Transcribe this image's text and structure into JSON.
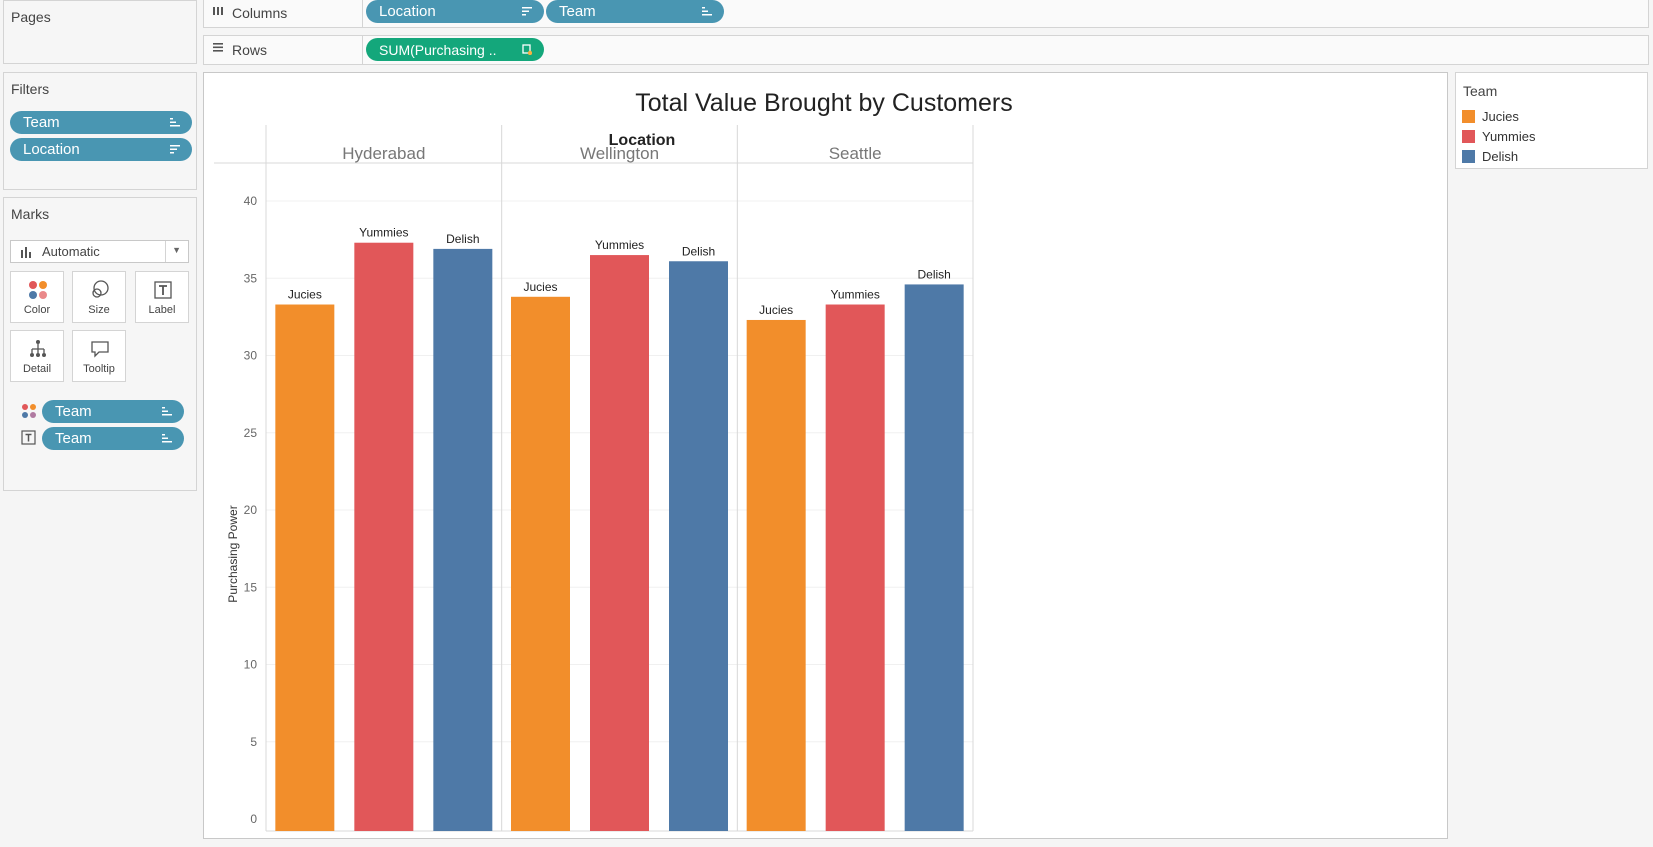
{
  "pages_panel": {
    "title": "Pages"
  },
  "columns_shelf": {
    "label": "Columns",
    "pills": [
      "Location",
      "Team"
    ]
  },
  "rows_shelf": {
    "label": "Rows",
    "pills": [
      "SUM(Purchasing .."
    ]
  },
  "filters_panel": {
    "title": "Filters",
    "pills": [
      "Team",
      "Location"
    ]
  },
  "marks_panel": {
    "title": "Marks",
    "mark_type": "Automatic",
    "buttons": [
      "Color",
      "Size",
      "Label",
      "Detail",
      "Tooltip"
    ],
    "pills": [
      "Team",
      "Team"
    ]
  },
  "legend": {
    "title": "Team",
    "items": [
      {
        "label": "Jucies",
        "color": "#f28e2b"
      },
      {
        "label": "Yummies",
        "color": "#e15759"
      },
      {
        "label": "Delish",
        "color": "#4e79a7"
      }
    ]
  },
  "chart_data": {
    "type": "bar",
    "title": "Total Value Brought by Customers",
    "column_header_title": "Location",
    "ylabel": "Purchasing Power",
    "ylim": [
      0,
      40
    ],
    "yticks": [
      0,
      5,
      10,
      15,
      20,
      25,
      30,
      35,
      40
    ],
    "categories": [
      "Hyderabad",
      "Wellington",
      "Seattle"
    ],
    "series": [
      {
        "name": "Jucies",
        "color": "#f28e2b",
        "values": [
          33.3,
          33.8,
          32.3
        ]
      },
      {
        "name": "Yummies",
        "color": "#e15759",
        "values": [
          37.3,
          36.5,
          33.3
        ]
      },
      {
        "name": "Delish",
        "color": "#4e79a7",
        "values": [
          36.9,
          36.1,
          34.6
        ]
      }
    ],
    "grid": true,
    "data_labels": "series name"
  }
}
